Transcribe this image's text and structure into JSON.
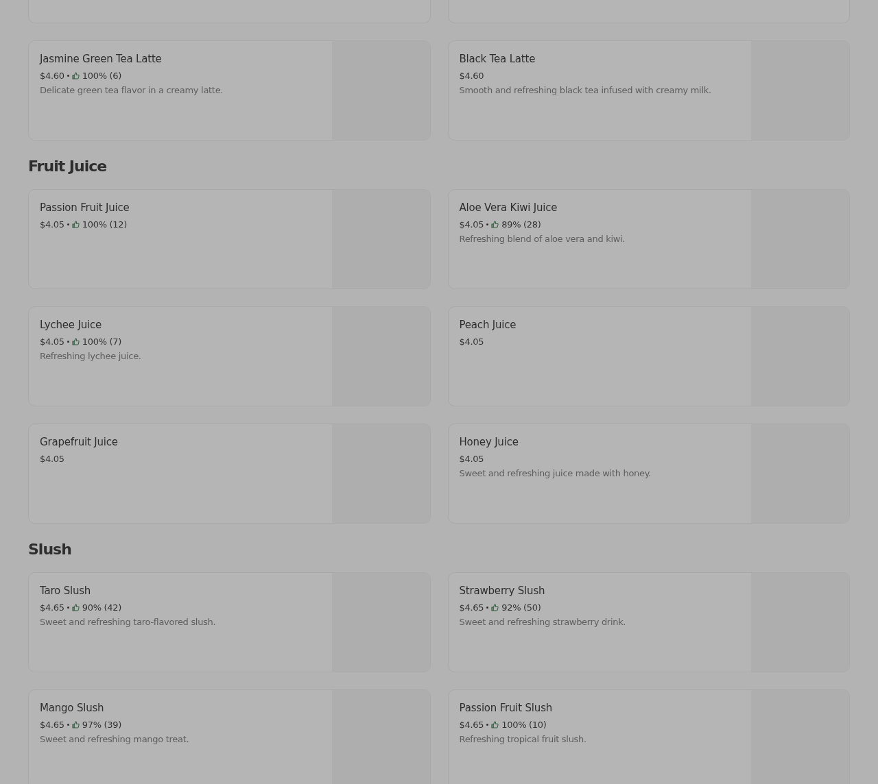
{
  "sections": [
    {
      "items": [
        {
          "name": "Jasmine Green Tea Latte",
          "price": "$4.60",
          "rating": "100% (6)",
          "description": "Delicate green tea flavor in a creamy latte."
        },
        {
          "name": "Black Tea Latte",
          "price": "$4.60",
          "description": "Smooth and refreshing black tea infused with creamy milk."
        }
      ]
    },
    {
      "title": "Fruit Juice",
      "items": [
        {
          "name": "Passion Fruit Juice",
          "price": "$4.05",
          "rating": "100% (12)"
        },
        {
          "name": "Aloe Vera Kiwi Juice",
          "price": "$4.05",
          "rating": "89% (28)",
          "description": "Refreshing blend of aloe vera and kiwi."
        },
        {
          "name": "Lychee Juice",
          "price": "$4.05",
          "rating": "100% (7)",
          "description": "Refreshing lychee juice."
        },
        {
          "name": "Peach Juice",
          "price": "$4.05"
        },
        {
          "name": "Grapefruit Juice",
          "price": "$4.05"
        },
        {
          "name": "Honey Juice",
          "price": "$4.05",
          "description": "Sweet and refreshing juice made with honey."
        }
      ]
    },
    {
      "title": "Slush",
      "items": [
        {
          "name": "Taro Slush",
          "price": "$4.65",
          "rating": "90% (42)",
          "description": "Sweet and refreshing taro-flavored slush."
        },
        {
          "name": "Strawberry Slush",
          "price": "$4.65",
          "rating": "92% (50)",
          "description": "Sweet and refreshing strawberry drink."
        },
        {
          "name": "Mango Slush",
          "price": "$4.65",
          "rating": "97% (39)",
          "description": "Sweet and refreshing mango treat."
        },
        {
          "name": "Passion Fruit Slush",
          "price": "$4.65",
          "rating": "100% (10)",
          "description": "Refreshing tropical fruit slush."
        }
      ]
    }
  ]
}
